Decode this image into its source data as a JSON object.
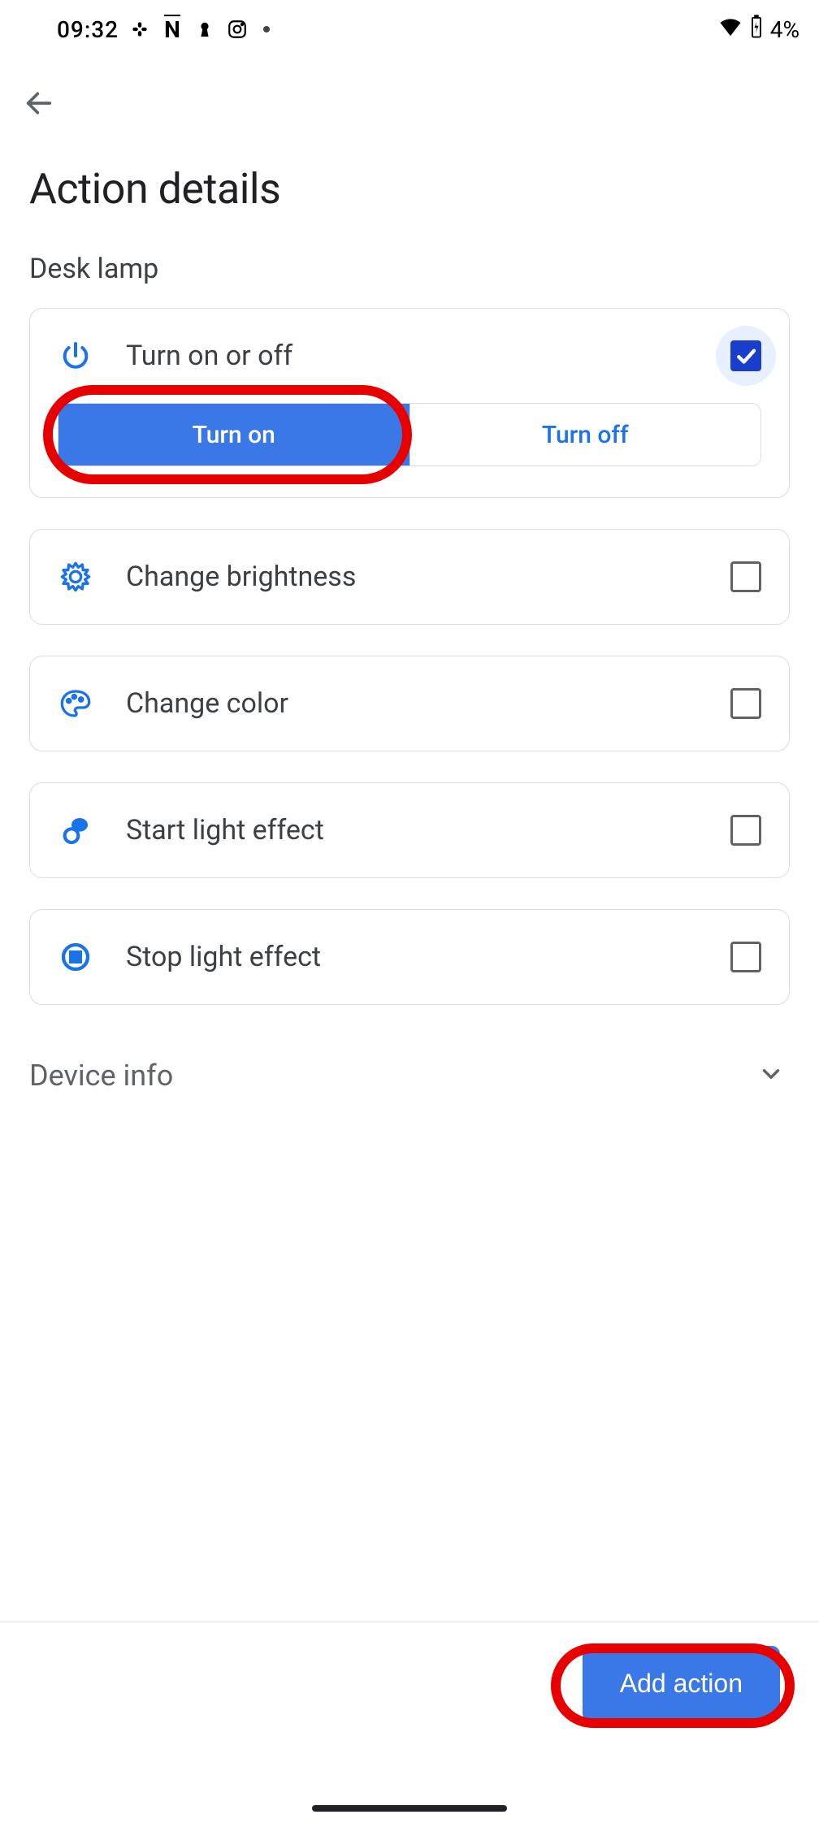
{
  "statusbar": {
    "time": "09:32",
    "battery_text": "4%"
  },
  "page": {
    "title": "Action details",
    "subtitle": "Desk lamp"
  },
  "actions": {
    "power": {
      "label": "Turn on or off",
      "on_label": "Turn on",
      "off_label": "Turn off",
      "checked": true,
      "selected": "on"
    },
    "brightness": {
      "label": "Change brightness",
      "checked": false
    },
    "color": {
      "label": "Change color",
      "checked": false
    },
    "start_effect": {
      "label": "Start light effect",
      "checked": false
    },
    "stop_effect": {
      "label": "Stop light effect",
      "checked": false
    }
  },
  "device_info": {
    "label": "Device info"
  },
  "footer": {
    "add_action_label": "Add action"
  }
}
